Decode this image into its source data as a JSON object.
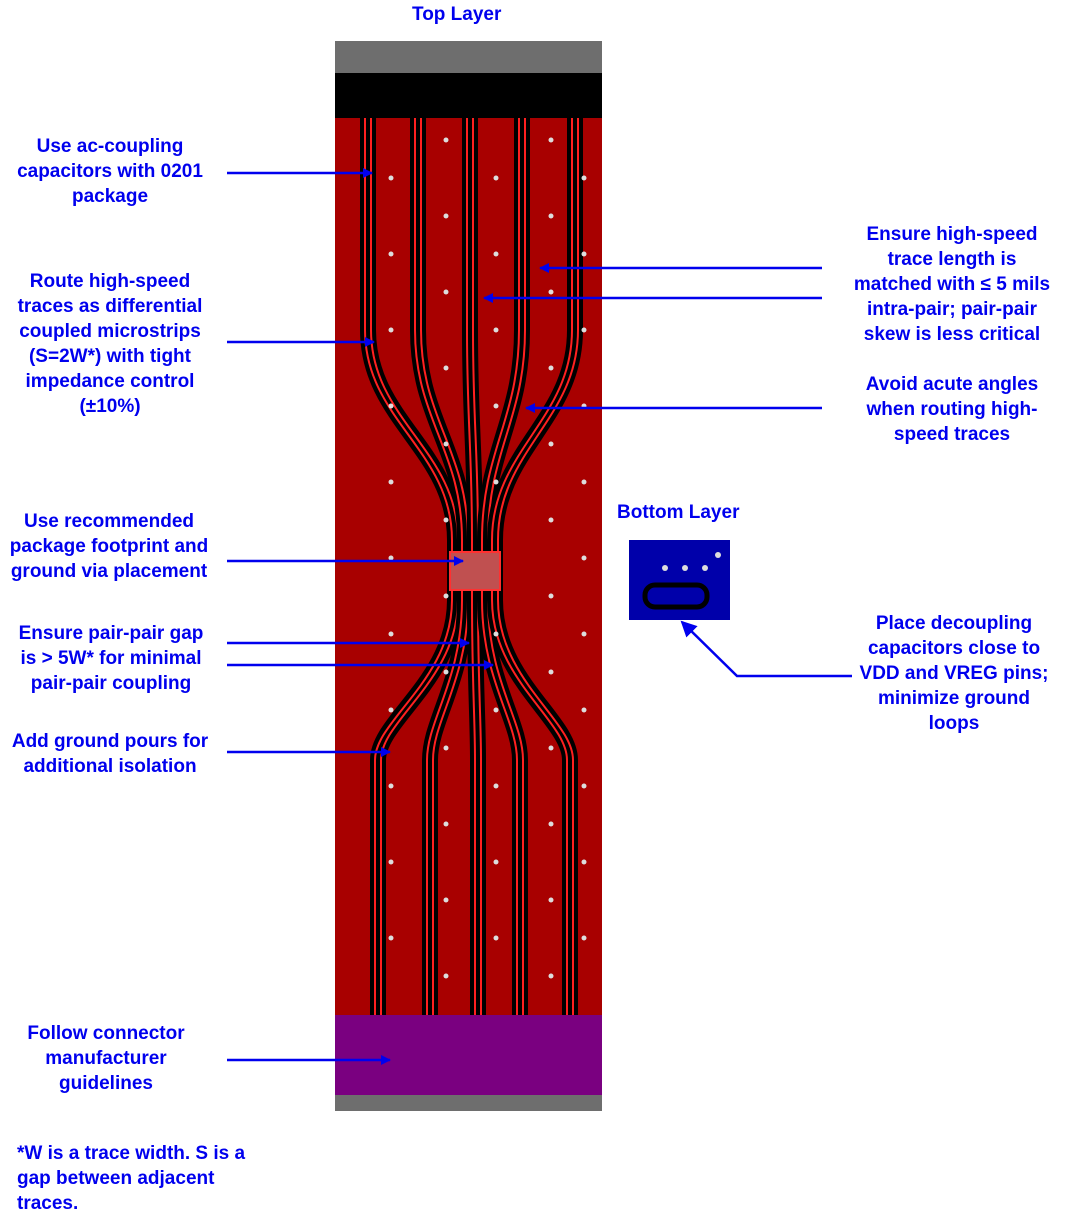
{
  "titles": {
    "top_layer": "Top Layer",
    "bottom_layer": "Bottom Layer"
  },
  "colors": {
    "annotation": "#0000ee",
    "copper_pour": "#a80000",
    "trace_red": "#ff0000",
    "gap_black": "#000000",
    "connector_purple": "#7a0080",
    "board_edge_gray": "#6e6e6e",
    "bottom_layer_blue": "#0000aa"
  },
  "annotations": {
    "ac_coupling": "Use ac-coupling\ncapacitors with 0201\npackage",
    "differential": "Route high-speed\ntraces as differential\ncoupled microstrips\n(S=2W*) with tight\nimpedance control\n(±10%)",
    "footprint": "Use recommended\npackage footprint and\nground via placement",
    "pair_gap": "Ensure pair-pair gap\nis > 5W* for minimal\npair-pair coupling",
    "ground_pours": "Add ground pours for\nadditional isolation",
    "connector": "Follow connector\nmanufacturer\nguidelines",
    "length_match": "Ensure high-speed\ntrace length is\nmatched with ≤ 5 mils\nintra-pair;  pair-pair\nskew is less critical",
    "acute_angles": "Avoid acute angles\nwhen routing high-\nspeed traces",
    "decoupling": "Place decoupling\ncapacitors close to\nVDD and VREG pins;\nminimize ground\nloops"
  },
  "footnote": "*W is a trace width.  S is a\ngap between adjacent\ntraces."
}
